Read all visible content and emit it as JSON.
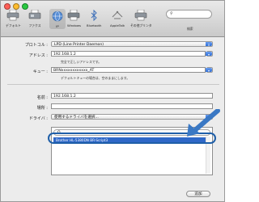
{
  "toolbar": {
    "items": [
      {
        "label": "デフォルト",
        "icon": "printer-icon"
      },
      {
        "label": "ファクス",
        "icon": "fax-icon"
      },
      {
        "label": "IP",
        "icon": "globe-icon"
      },
      {
        "label": "Windows",
        "icon": "windows-printer-icon"
      },
      {
        "label": "Bluetooth",
        "icon": "bluetooth-icon"
      },
      {
        "label": "AppleTalk",
        "icon": "appletalk-icon"
      },
      {
        "label": "その他プリンタ",
        "icon": "more-printers-icon"
      }
    ],
    "search_hint": "検索"
  },
  "form": {
    "protocol_label": "プロトコル :",
    "protocol_value": "LPD (Line Printer Daemon)",
    "address_label": "アドレス :",
    "address_value": "192.168.1.2",
    "address_note": "完全で正しいアドレスです。",
    "queue_label": "キュー :",
    "queue_value": "BRNxxxxxxxxxxxx_AT",
    "queue_note": "デフォルトキューの場合は、空のままにします。",
    "name_label": "名前 :",
    "name_value": "192.168.1.2",
    "location_label": "場所 :",
    "location_value": "",
    "driver_label": "ドライバ :",
    "driver_value": "使用するドライバを選択..."
  },
  "driver_list": {
    "search_placeholder": "Q",
    "selected_item": "Brother HL-5380DN BR-Script3"
  },
  "add_button": "追加",
  "colors": {
    "accent_blue": "#2f68c8",
    "highlight_outline": "#1f5fa8",
    "callout_arrow": "#3a78c4"
  }
}
